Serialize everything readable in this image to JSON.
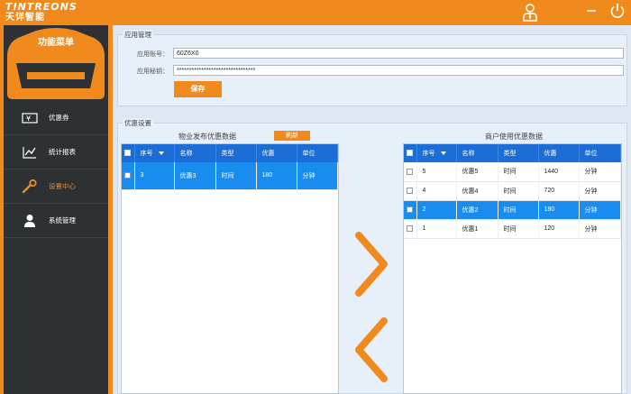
{
  "brand": {
    "en": "TINTREONS",
    "cn": "天详智能"
  },
  "header": {
    "user_icon": "user-icon",
    "minimize_icon": "minimize-icon",
    "power_icon": "power-icon"
  },
  "sidebar": {
    "title": "功能菜单",
    "items": [
      {
        "label": "优惠券",
        "icon": "coupon-icon",
        "active": false
      },
      {
        "label": "统计报表",
        "icon": "chart-icon",
        "active": false
      },
      {
        "label": "设置中心",
        "icon": "wrench-icon",
        "active": true
      },
      {
        "label": "系统管理",
        "icon": "admin-icon",
        "active": false
      }
    ]
  },
  "app_management": {
    "title": "应用管理",
    "account_label": "应用账号：",
    "account_value": "60Z6X0",
    "secret_label": "应用秘钥：",
    "secret_value": "********************************",
    "save_label": "保存"
  },
  "discount_settings": {
    "title": "优惠设置",
    "left_title": "物业发布优惠数据",
    "refresh_label": "刷新",
    "right_title": "商户使用优惠数据",
    "columns": [
      "序号",
      "名称",
      "类型",
      "优惠",
      "单位"
    ],
    "left_rows": [
      {
        "no": "3",
        "name": "优惠3",
        "type": "时间",
        "value": "180",
        "unit": "分钟",
        "selected": true
      }
    ],
    "right_rows": [
      {
        "no": "5",
        "name": "优惠5",
        "type": "时间",
        "value": "1440",
        "unit": "分钟",
        "selected": false
      },
      {
        "no": "4",
        "name": "优惠4",
        "type": "时间",
        "value": "720",
        "unit": "分钟",
        "selected": false
      },
      {
        "no": "2",
        "name": "优惠2",
        "type": "时间",
        "value": "180",
        "unit": "分钟",
        "selected": true
      },
      {
        "no": "1",
        "name": "优惠1",
        "type": "时间",
        "value": "120",
        "unit": "分钟",
        "selected": false
      }
    ]
  },
  "colors": {
    "accent": "#f08a1c",
    "header_blue": "#1c6ed6",
    "selected_row": "#1a8cf0",
    "sidebar_dark": "#2d3133"
  }
}
